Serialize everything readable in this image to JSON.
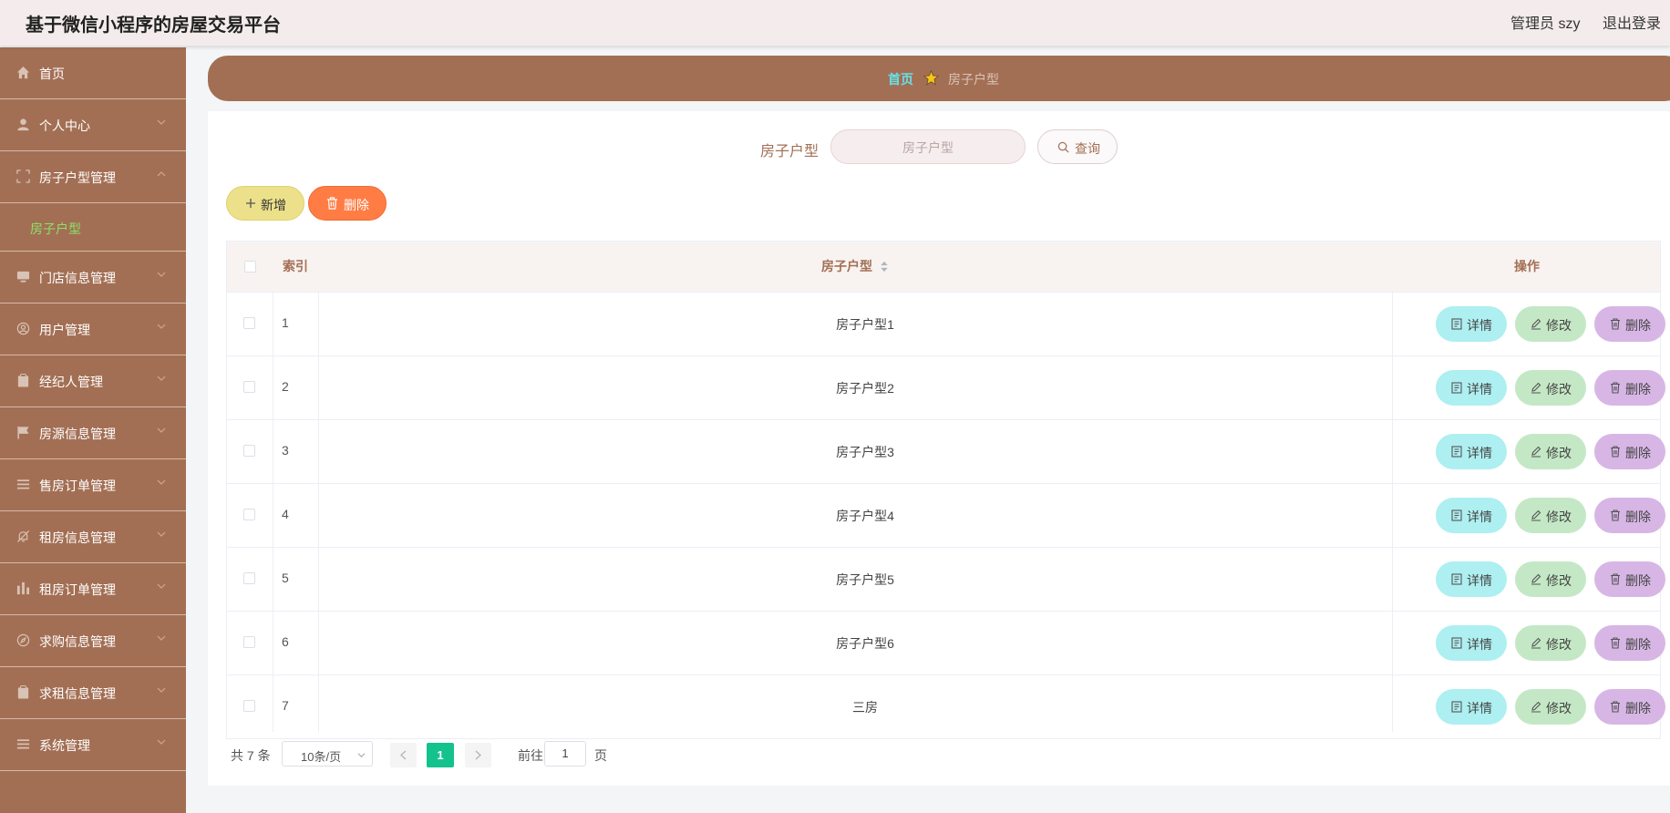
{
  "header": {
    "title": "基于微信小程序的房屋交易平台",
    "admin": "管理员 szy",
    "logout": "退出登录"
  },
  "sidebar": {
    "items": [
      {
        "label": "首页",
        "icon": "home-icon"
      },
      {
        "label": "个人中心",
        "icon": "user-icon"
      },
      {
        "label": "房子户型管理",
        "icon": "fullscreen-icon",
        "expanded": true,
        "children": [
          "房子户型"
        ]
      },
      {
        "label": "门店信息管理",
        "icon": "monitor-icon"
      },
      {
        "label": "用户管理",
        "icon": "user-circle-icon"
      },
      {
        "label": "经纪人管理",
        "icon": "clipboard-icon"
      },
      {
        "label": "房源信息管理",
        "icon": "flag-icon"
      },
      {
        "label": "售房订单管理",
        "icon": "list-icon"
      },
      {
        "label": "租房信息管理",
        "icon": "bell-off-icon"
      },
      {
        "label": "租房订单管理",
        "icon": "chart-icon"
      },
      {
        "label": "求购信息管理",
        "icon": "compass-icon"
      },
      {
        "label": "求租信息管理",
        "icon": "clipboard-icon"
      },
      {
        "label": "系统管理",
        "icon": "list-icon"
      }
    ]
  },
  "breadcrumb": {
    "home": "首页",
    "current": "房子户型"
  },
  "search": {
    "label": "房子户型",
    "placeholder": "房子户型",
    "button": "查询"
  },
  "actions": {
    "add": "新增",
    "delete": "删除"
  },
  "table": {
    "columns": {
      "index": "索引",
      "name": "房子户型",
      "ops": "操作"
    },
    "rows": [
      {
        "index": "1",
        "name": "房子户型1"
      },
      {
        "index": "2",
        "name": "房子户型2"
      },
      {
        "index": "3",
        "name": "房子户型3"
      },
      {
        "index": "4",
        "name": "房子户型4"
      },
      {
        "index": "5",
        "name": "房子户型5"
      },
      {
        "index": "6",
        "name": "房子户型6"
      },
      {
        "index": "7",
        "name": "三房"
      }
    ],
    "ops": {
      "detail": "详情",
      "edit": "修改",
      "delete": "删除"
    }
  },
  "pagination": {
    "total": "共 7 条",
    "page_size": "10条/页",
    "current": "1",
    "goto_prefix": "前往",
    "goto_value": "1",
    "goto_suffix": "页"
  },
  "colors": {
    "sidebar": "#a36f54",
    "accent_green": "#14c28d",
    "detail": "#aeeff1",
    "edit": "#c4e8c6",
    "delete": "#d7b6e5",
    "add": "#ece18a",
    "danger": "#ff7d45"
  }
}
